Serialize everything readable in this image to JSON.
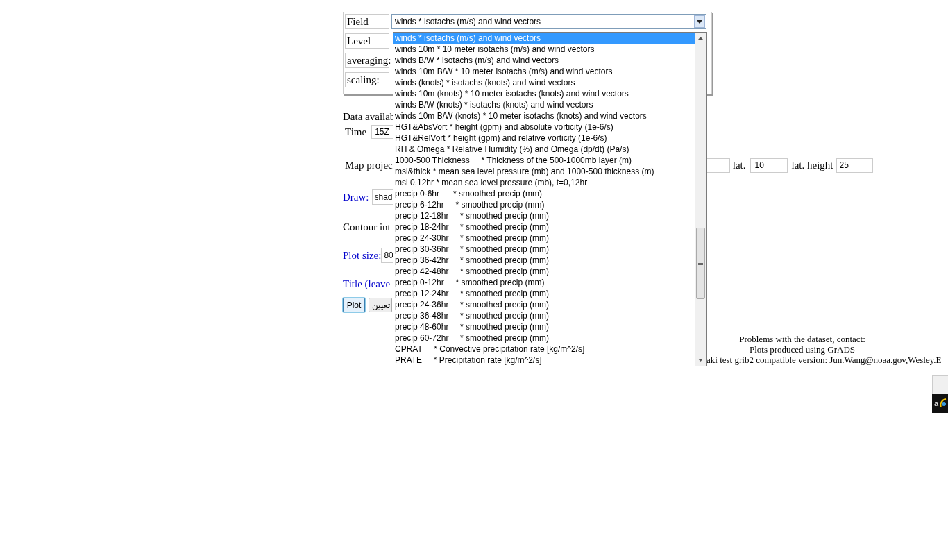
{
  "form": {
    "rows": [
      {
        "label": "Field",
        "value": "winds * isotachs (m/s) and wind vectors"
      },
      {
        "label": "Level"
      },
      {
        "label": "averaging:"
      },
      {
        "label": "scaling:"
      }
    ]
  },
  "dropdown": {
    "options": [
      {
        "label": "winds * isotachs (m/s) and wind vectors",
        "selected": true
      },
      {
        "label": "winds 10m * 10 meter isotachs (m/s) and wind vectors",
        "selected": false
      },
      {
        "label": "winds B/W * isotachs (m/s) and wind vectors",
        "selected": false
      },
      {
        "label": "winds 10m B/W * 10 meter isotachs (m/s) and wind vectors",
        "selected": false
      },
      {
        "label": "winds (knots) * isotachs (knots) and wind vectors",
        "selected": false
      },
      {
        "label": "winds 10m (knots) * 10 meter isotachs (knots) and wind vectors",
        "selected": false
      },
      {
        "label": "winds B/W (knots) * isotachs (knots) and wind vectors",
        "selected": false
      },
      {
        "label": "winds 10m B/W (knots) * 10 meter isotachs (knots) and wind vectors",
        "selected": false
      },
      {
        "label": "HGT&AbsVort * height (gpm) and absolute vorticity (1e-6/s)",
        "selected": false
      },
      {
        "label": "HGT&RelVort * height (gpm) and relative vorticity (1e-6/s)",
        "selected": false
      },
      {
        "label": "RH & Omega * Relative Humidity (%) and Omega (dp/dt) (Pa/s)",
        "selected": false
      },
      {
        "label": "1000-500 Thickness     * Thickness of the 500-1000mb layer (m)",
        "selected": false
      },
      {
        "label": "msl&thick * mean sea level pressure (mb) and 1000-500 thickness (m)",
        "selected": false
      },
      {
        "label": "msl 0,12hr * mean sea level pressure (mb), t=0,12hr",
        "selected": false
      },
      {
        "label": "precip 0-6hr      * smoothed precip (mm)",
        "selected": false
      },
      {
        "label": "precip 6-12hr     * smoothed precip (mm)",
        "selected": false
      },
      {
        "label": "precip 12-18hr     * smoothed precip (mm)",
        "selected": false
      },
      {
        "label": "precip 18-24hr     * smoothed precip (mm)",
        "selected": false
      },
      {
        "label": "precip 24-30hr     * smoothed precip (mm)",
        "selected": false
      },
      {
        "label": "precip 30-36hr     * smoothed precip (mm)",
        "selected": false
      },
      {
        "label": "precip 36-42hr     * smoothed precip (mm)",
        "selected": false
      },
      {
        "label": "precip 42-48hr     * smoothed precip (mm)",
        "selected": false
      },
      {
        "label": "precip 0-12hr     * smoothed precip (mm)",
        "selected": false
      },
      {
        "label": "precip 12-24hr     * smoothed precip (mm)",
        "selected": false
      },
      {
        "label": "precip 24-36hr     * smoothed precip (mm)",
        "selected": false
      },
      {
        "label": "precip 36-48hr     * smoothed precip (mm)",
        "selected": false
      },
      {
        "label": "precip 48-60hr     * smoothed precip (mm)",
        "selected": false
      },
      {
        "label": "precip 60-72hr     * smoothed precip (mm)",
        "selected": false
      },
      {
        "label": "CPRAT     * Convective precipitation rate [kg/m^2/s]",
        "selected": false
      },
      {
        "label": "PRATE     * Precipitation rate [kg/m^2/s]",
        "selected": false
      }
    ]
  },
  "data_available": "Data availab",
  "time": {
    "label": "Time",
    "value": "15Z"
  },
  "map_projection": {
    "label": "Map projec",
    "lat_label": "lat.",
    "lat_value": "10",
    "lat_height_label": "lat. height",
    "lat_height_value": "25"
  },
  "draw": {
    "label": "Draw:",
    "value": "shad"
  },
  "contour_interval": "Contour int",
  "plot_size": {
    "label": "Plot size:",
    "value": "80"
  },
  "title_label": "Title (leave",
  "buttons": [
    {
      "label": "Plot",
      "focused": true
    },
    {
      "label": "تعيين",
      "focused": false
    }
  ],
  "footer": [
    "Problems with the dataset, contact:",
    "Plots produced using GrADS",
    "aki test grib2 compatible version: Jun.Wang@noaa.gov,Wesley.E"
  ],
  "taskbar": {
    "text": "a"
  }
}
